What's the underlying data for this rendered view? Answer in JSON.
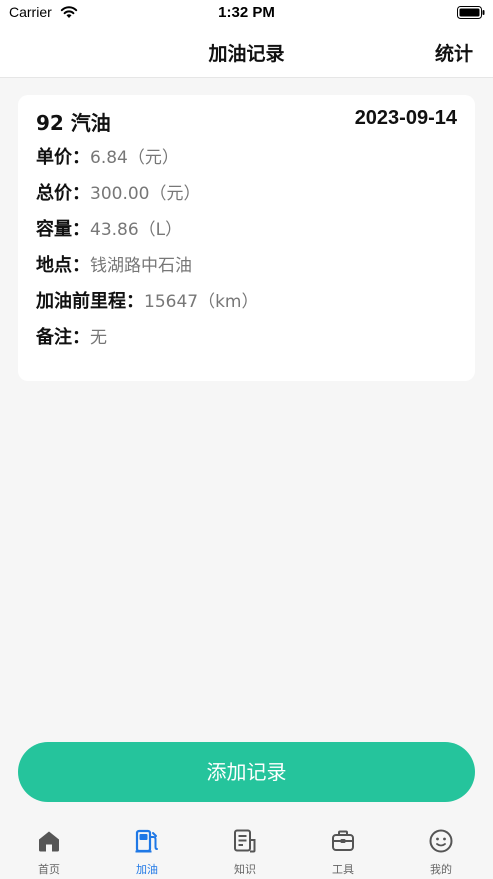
{
  "status_bar": {
    "carrier": "Carrier",
    "time": "1:32 PM"
  },
  "nav": {
    "title": "加油记录",
    "action": "统计"
  },
  "record": {
    "fuel_type": "92 汽油",
    "date": "2023-09-14",
    "fields": [
      {
        "label": "单价：",
        "value": "6.84（元）"
      },
      {
        "label": "总价：",
        "value": "300.00（元）"
      },
      {
        "label": "容量：",
        "value": "43.86（L）"
      },
      {
        "label": "地点：",
        "value": "钱湖路中石油"
      },
      {
        "label": "加油前里程：",
        "value": "15647（km）"
      },
      {
        "label": "备注：",
        "value": "无"
      }
    ]
  },
  "add_button_label": "添加记录",
  "tabs": [
    {
      "label": "首页",
      "icon": "home-icon",
      "active": false
    },
    {
      "label": "加油",
      "icon": "fuel-pump-icon",
      "active": true
    },
    {
      "label": "知识",
      "icon": "document-icon",
      "active": false
    },
    {
      "label": "工具",
      "icon": "toolbox-icon",
      "active": false
    },
    {
      "label": "我的",
      "icon": "profile-face-icon",
      "active": false
    }
  ],
  "colors": {
    "accent": "#25c49c",
    "tab_active": "#1f78e6",
    "tab_inactive": "#666666"
  }
}
